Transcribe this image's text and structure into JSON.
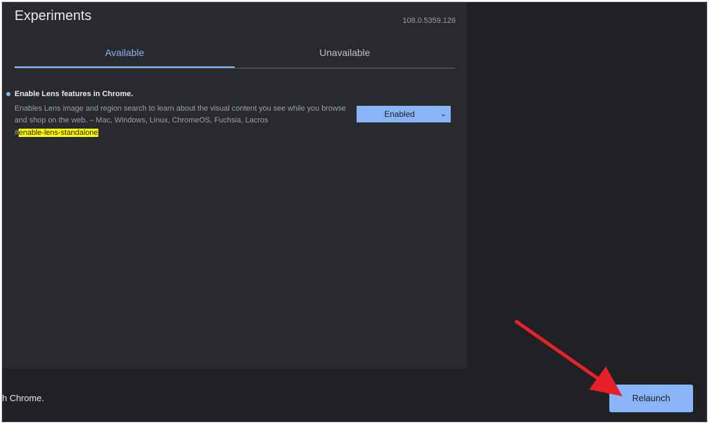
{
  "header": {
    "title": "Experiments",
    "version": "108.0.5359.126"
  },
  "tabs": [
    {
      "label": "Available",
      "active": true
    },
    {
      "label": "Unavailable",
      "active": false
    }
  ],
  "experiment": {
    "name": "Enable Lens features in Chrome.",
    "description": "Enables Lens image and region search to learn about the visual content you see while you browse and shop on the web. – Mac, Windows, Linux, ChromeOS, Fuchsia, Lacros",
    "hash": "#",
    "flag_id": "enable-lens-standalone",
    "selected_option": "Enabled"
  },
  "footer": {
    "message": "h Chrome.",
    "relaunch_label": "Relaunch"
  },
  "colors": {
    "accent": "#8ab4f8",
    "highlight": "#ffff00",
    "annotation_arrow": "#e8202a"
  },
  "icons": {
    "select_chevron": "chevron-down-icon",
    "annotation": "red-arrow-icon"
  }
}
